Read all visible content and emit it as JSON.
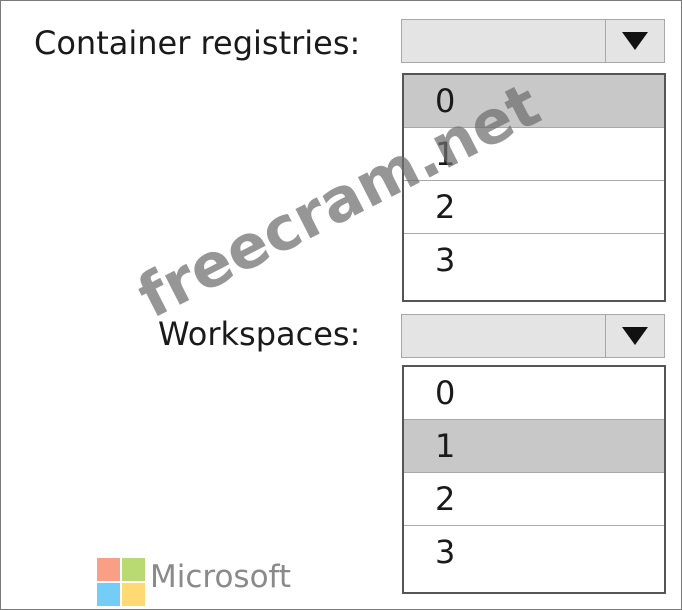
{
  "fields": [
    {
      "label": "Container registries:",
      "options": [
        "0",
        "1",
        "2",
        "3"
      ],
      "selected_index": 0
    },
    {
      "label": "Workspaces:",
      "options": [
        "0",
        "1",
        "2",
        "3"
      ],
      "selected_index": 1
    }
  ],
  "brand": {
    "logo_icon": "microsoft-logo-icon",
    "text": "Microsoft",
    "colors": [
      "#f25022",
      "#7fba00",
      "#00a4ef",
      "#ffb900"
    ]
  },
  "watermark": {
    "text": "freecram.net"
  },
  "colors": {
    "selected_option": "#c8c8c8",
    "select_background": "#e4e4e4"
  }
}
